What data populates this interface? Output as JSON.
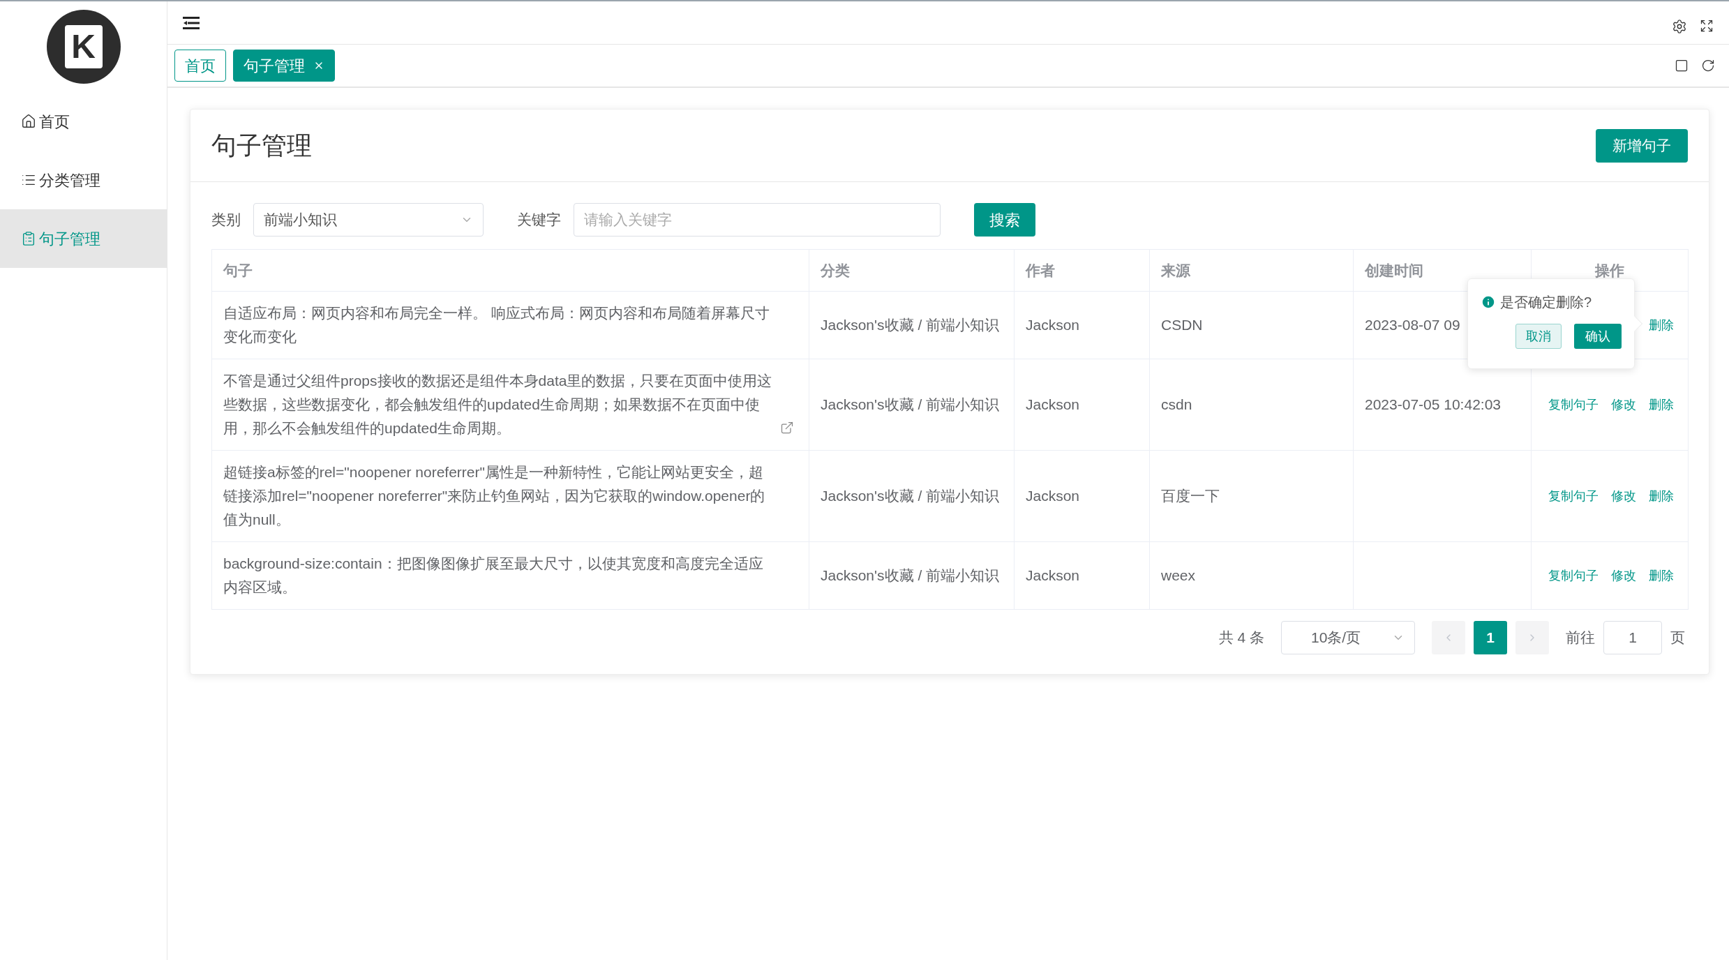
{
  "logo": {
    "letter": "K"
  },
  "sidebar": {
    "items": [
      {
        "label": "首页",
        "selected": false
      },
      {
        "label": "分类管理",
        "selected": false
      },
      {
        "label": "句子管理",
        "selected": true
      }
    ]
  },
  "tabs": [
    {
      "label": "首页",
      "selected": false,
      "closable": false
    },
    {
      "label": "句子管理",
      "selected": true,
      "closable": true
    }
  ],
  "page": {
    "title": "句子管理",
    "add_button": "新增句子"
  },
  "filters": {
    "category_label": "类别",
    "category_value": "前端小知识",
    "keyword_label": "关键字",
    "keyword_placeholder": "请输入关键字",
    "search_button": "搜索"
  },
  "table": {
    "columns": [
      "句子",
      "分类",
      "作者",
      "来源",
      "创建时间",
      "操作"
    ],
    "rows": [
      {
        "sentence": "自适应布局：网页内容和布局完全一样。 响应式布局：网页内容和布局随着屏幕尺寸变化而变化",
        "external_link": false,
        "category": "Jackson's收藏 / 前端小知识",
        "author": "Jackson",
        "source": "CSDN",
        "created": "2023-08-07 09",
        "actions": [
          "删除"
        ]
      },
      {
        "sentence": "不管是通过父组件props接收的数据还是组件本身data里的数据，只要在页面中使用这些数据，这些数据变化，都会触发组件的updated生命周期；如果数据不在页面中使用，那么不会触发组件的updated生命周期。",
        "external_link": true,
        "category": "Jackson's收藏 / 前端小知识",
        "author": "Jackson",
        "source": "csdn",
        "created": "2023-07-05 10:42:03",
        "actions": [
          "复制句子",
          "修改",
          "删除"
        ]
      },
      {
        "sentence": "超链接a标签的rel=\"noopener noreferrer\"属性是一种新特性，它能让网站更安全，超链接添加rel=\"noopener noreferrer\"来防止钓鱼网站，因为它获取的window.opener的值为null。",
        "external_link": false,
        "category": "Jackson's收藏 / 前端小知识",
        "author": "Jackson",
        "source": "百度一下",
        "created": "",
        "actions": [
          "复制句子",
          "修改",
          "删除"
        ]
      },
      {
        "sentence": "background-size:contain：把图像图像扩展至最大尺寸，以使其宽度和高度完全适应内容区域。",
        "external_link": false,
        "category": "Jackson's收藏 / 前端小知识",
        "author": "Jackson",
        "source": "weex",
        "created": "",
        "actions": [
          "复制句子",
          "修改",
          "删除"
        ]
      }
    ]
  },
  "popover": {
    "message": "是否确定删除?",
    "cancel": "取消",
    "confirm": "确认"
  },
  "pagination": {
    "total": "共 4 条",
    "page_size": "10条/页",
    "pages": [
      {
        "label": "1",
        "selected": true
      }
    ],
    "goto_label": "前往",
    "goto_value": "1",
    "goto_suffix": "页"
  }
}
